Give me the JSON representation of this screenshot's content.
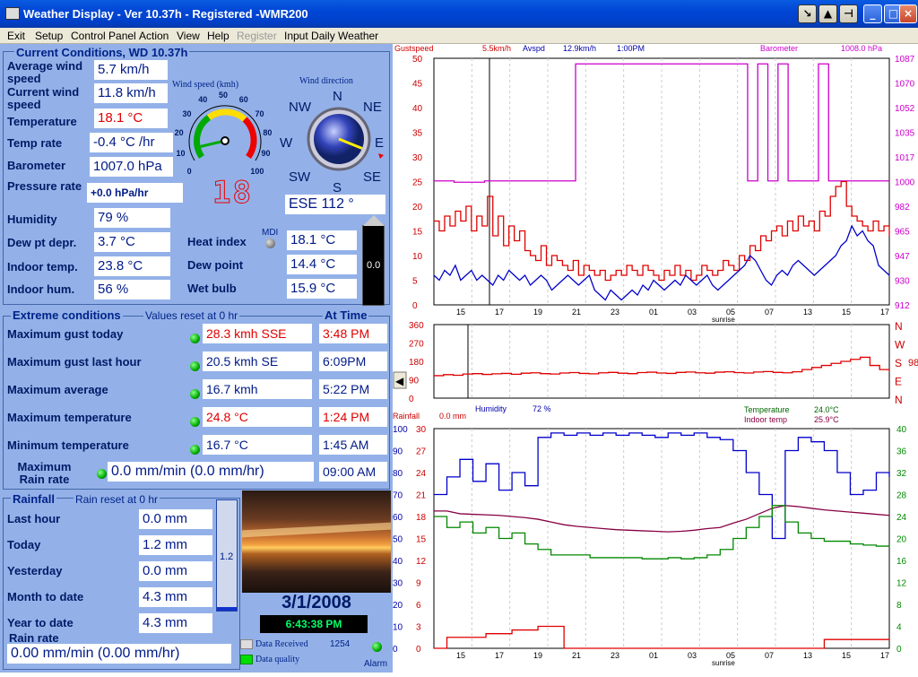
{
  "window": {
    "title": "Weather Display - Ver 10.37h - Registered   -WMR200"
  },
  "menu": [
    "Exit",
    "Setup",
    "Control Panel",
    "Action",
    "View",
    "Help",
    "Register",
    "Input Daily Weather"
  ],
  "current": {
    "header": "Current Conditions, WD 10.37h",
    "avg_wind_label": "Average wind speed",
    "avg_wind": "5.7 km/h",
    "cur_wind_label": "Current wind speed",
    "cur_wind": "11.8 km/h",
    "temp_label": "Temperature",
    "temp": "18.1 °C",
    "temp_rate_label": "Temp rate",
    "temp_rate": "-0.4 °C /hr",
    "baro_label": "Barometer",
    "baro": "1007.0 hPa",
    "pressure_rate_label": "Pressure rate",
    "pressure_rate": "+0.0 hPa/hr",
    "humidity_label": "Humidity",
    "humidity": "79 %",
    "dewdepr_label": "Dew pt depr.",
    "dewdepr": "3.7 °C",
    "indoor_temp_label": "Indoor temp.",
    "indoor_temp": "23.8 °C",
    "indoor_hum_label": "Indoor hum.",
    "indoor_hum": "56 %",
    "heat_label": "Heat index",
    "heat": "18.1 °C",
    "dewpoint_label": "Dew point",
    "dewpoint": "14.4 °C",
    "wetbulb_label": "Wet bulb",
    "wetbulb": "15.9 °C",
    "mdi": "MDI",
    "gauge_title": "Wind speed (kmh)",
    "gauge_ticks": [
      "0",
      "10",
      "20",
      "30",
      "40",
      "50",
      "60",
      "70",
      "80",
      "90",
      "100"
    ],
    "gauge_value": 11.8,
    "digital": "18",
    "dir_title": "Wind direction",
    "dir_labels": [
      "N",
      "NE",
      "E",
      "SE",
      "S",
      "SW",
      "W",
      "NW"
    ],
    "dir_value": "ESE  112 °",
    "dir_deg": 112,
    "bar_value": "0.0"
  },
  "extremes": {
    "header": "Extreme conditions",
    "reset": "Values reset at 0 hr",
    "at_time": "At Time",
    "rows": [
      {
        "label": "Maximum gust today",
        "value": "28.3 kmh SSE",
        "time": "3:48 PM",
        "red": true
      },
      {
        "label": "Maximum gust last hour",
        "value": "20.5 kmh  SE",
        "time": "6:09PM",
        "red": false
      },
      {
        "label": "Maximum average",
        "value": "16.7 kmh",
        "time": "5:22 PM",
        "red": false
      },
      {
        "label": "Maximum temperature",
        "value": "24.8 °C",
        "time": "1:24 PM",
        "red": true
      },
      {
        "label": "Minimum temperature",
        "value": "16.7 °C",
        "time": "1:45 AM",
        "red": false
      }
    ],
    "rain_label": "Maximum Rain rate",
    "rain_value": "0.0 mm/min (0.0 mm/hr)",
    "rain_time": "09:00 AM"
  },
  "rainfall": {
    "header": "Rainfall",
    "reset": "Rain reset at 0 hr",
    "rows": [
      {
        "label": "Last hour",
        "value": "0.0 mm"
      },
      {
        "label": "Today",
        "value": "1.2 mm"
      },
      {
        "label": "Yesterday",
        "value": "0.0 mm"
      },
      {
        "label": "Month to date",
        "value": "4.3 mm"
      },
      {
        "label": "Year to date",
        "value": "4.3 mm"
      }
    ],
    "rate_label": "Rain rate",
    "rate_value": "0.00 mm/min (0.00 mm/hr)",
    "tube_value": "1.2"
  },
  "status": {
    "date": "3/1/2008",
    "time": "6:43:38 PM",
    "data_received": "Data Received",
    "count": "1254",
    "data_quality": "Data quality",
    "alarm": "Alarm"
  },
  "colors": {
    "red": "#e00000",
    "blue": "#0000cc",
    "magenta": "#cc00cc",
    "green": "#008800",
    "purple": "#880044"
  },
  "chart_data": [
    {
      "type": "line",
      "legend": {
        "gust": "Gustspeed",
        "gust_val": "5.5km/h",
        "avg": "Avspd",
        "avg_val": "12.9km/h",
        "time": "1:00PM",
        "baro": "Barometer",
        "baro_val": "1008.0 hPa"
      },
      "x_ticks": [
        "15",
        "17",
        "19",
        "21",
        "23",
        "01",
        "03",
        "05",
        "07",
        "13",
        "15",
        "17"
      ],
      "x_note": "sunrise",
      "y_left": [
        0,
        5,
        10,
        15,
        20,
        25,
        30,
        35,
        40,
        45,
        50
      ],
      "y_right": [
        "912",
        "930",
        "947",
        "965",
        "982",
        "1000",
        "1017",
        "1035",
        "1052",
        "1070",
        "1087"
      ],
      "series": [
        {
          "values": [
            17,
            15,
            18,
            16,
            19,
            17,
            20,
            15,
            18,
            16,
            22,
            14,
            18,
            12,
            16,
            13,
            15,
            11,
            10,
            9,
            12,
            8,
            10,
            9,
            8,
            7,
            9,
            6,
            8,
            7,
            6,
            7,
            5,
            6,
            7,
            6,
            8,
            7,
            6,
            8,
            7,
            6,
            5,
            7,
            6,
            8,
            6,
            7,
            5,
            6,
            8,
            7,
            6,
            7,
            9,
            8,
            7,
            10,
            9,
            12,
            11,
            14,
            13,
            15,
            16,
            14,
            17,
            15,
            18,
            16,
            17,
            15,
            19,
            18,
            22,
            24,
            25,
            20,
            18,
            17,
            16,
            15,
            17,
            15,
            16,
            14
          ]
        },
        {
          "values": [
            6,
            5,
            7,
            6,
            8,
            5,
            6,
            7,
            5,
            6,
            5,
            4,
            6,
            5,
            7,
            6,
            5,
            6,
            4,
            5,
            6,
            5,
            3,
            4,
            5,
            6,
            5,
            4,
            5,
            6,
            3,
            2,
            1,
            3,
            2,
            1,
            2,
            3,
            2,
            4,
            3,
            5,
            4,
            3,
            4,
            5,
            4,
            6,
            5,
            4,
            5,
            6,
            4,
            3,
            4,
            5,
            6,
            7,
            8,
            10,
            9,
            7,
            5,
            4,
            6,
            7,
            6,
            8,
            9,
            8,
            7,
            6,
            7,
            8,
            9,
            10,
            12,
            13,
            16,
            14,
            15,
            13,
            12,
            8,
            7,
            6
          ]
        },
        {
          "values": [
            1000,
            1000,
            999,
            999,
            999,
            1000,
            1000,
            1000,
            1000,
            1000,
            1000,
            1000,
            1000,
            1000,
            1083,
            1083,
            1083,
            1083,
            1083,
            1083,
            1083,
            1083,
            1083,
            1083,
            1083,
            1083,
            1083,
            1083,
            1083,
            1083,
            1083,
            1000,
            1083,
            1000,
            1083,
            1000,
            1000,
            1000,
            1083,
            1000,
            1000,
            1000,
            1000,
            1000,
            1000,
            1000
          ]
        }
      ]
    },
    {
      "type": "line",
      "legend": {
        "rain": "Rainfall",
        "rain_val": "0.0 mm",
        "hum": "Humidity",
        "hum_val": "72 %",
        "temp": "Temperature",
        "temp_val": "24.0°C",
        "itemp": "Indoor temp",
        "itemp_val": "25.9°C"
      },
      "y_left": [
        "360",
        "270",
        "180",
        "90",
        "0"
      ],
      "y_right": [
        "N",
        "W",
        "S",
        "E",
        "N"
      ],
      "side_val": "98",
      "values": [
        110,
        115,
        112,
        118,
        120,
        116,
        119,
        121,
        117,
        122,
        124,
        120,
        118,
        123,
        125,
        121,
        119,
        124,
        126,
        122,
        120,
        125,
        127,
        123,
        121,
        126,
        128,
        124,
        122,
        127,
        129,
        125,
        123,
        128,
        130,
        126,
        124,
        129,
        140,
        150,
        160,
        170,
        180,
        190,
        200,
        160,
        140,
        130
      ]
    },
    {
      "type": "line",
      "x_ticks": [
        "15",
        "17",
        "19",
        "21",
        "23",
        "01",
        "03",
        "05",
        "07",
        "13",
        "15",
        "17"
      ],
      "x_note": "sunrise",
      "y_outer": [
        "0",
        "10",
        "20",
        "30",
        "40",
        "50",
        "60",
        "70",
        "80",
        "90",
        "100"
      ],
      "y_left": [
        "0",
        "3",
        "6",
        "9",
        "12",
        "15",
        "18",
        "21",
        "24",
        "27",
        "30"
      ],
      "y_right": [
        "0",
        "4",
        "8",
        "12",
        "16",
        "20",
        "24",
        "28",
        "32",
        "36",
        "40"
      ],
      "series": [
        {
          "values": [
            70,
            78,
            86,
            76,
            84,
            72,
            80,
            74,
            96,
            98,
            97,
            98,
            97,
            98,
            97,
            98,
            97,
            96,
            98,
            97,
            98,
            96,
            95,
            90,
            80,
            70,
            50,
            90,
            96,
            94,
            90,
            80,
            70,
            72,
            80,
            78
          ]
        },
        {
          "values": [
            25,
            25,
            24.5,
            24.4,
            24.3,
            24.2,
            24,
            23.8,
            23.5,
            23,
            22.5,
            22.2,
            22,
            21.8,
            21.6,
            21.5,
            21.4,
            21.3,
            21.2,
            21.3,
            21.5,
            21.8,
            22,
            22.8,
            23.5,
            24.5,
            25.5,
            26,
            25.8,
            25.5,
            25.2,
            25,
            24.8,
            24.6,
            24.4,
            24.2
          ]
        },
        {
          "values": [
            24,
            22,
            23,
            21,
            22,
            20,
            21,
            19,
            18,
            17,
            17,
            17,
            16.5,
            16.5,
            16.5,
            16.5,
            16.3,
            16.3,
            16.5,
            16.3,
            16.5,
            17,
            18,
            20,
            22,
            24,
            26,
            23,
            21,
            20,
            19.5,
            19.5,
            19,
            18.8,
            18.6,
            18.5
          ]
        },
        {
          "values": [
            0,
            1.5,
            1.5,
            1.5,
            2,
            2,
            2.5,
            2.5,
            3,
            3,
            0,
            0,
            0,
            0,
            0,
            0,
            0,
            0,
            0,
            0,
            0,
            0,
            0,
            0,
            0,
            0,
            0,
            0,
            0,
            0,
            1.2,
            1.2,
            1.2,
            1.2,
            1.2,
            1.2
          ]
        }
      ]
    }
  ]
}
